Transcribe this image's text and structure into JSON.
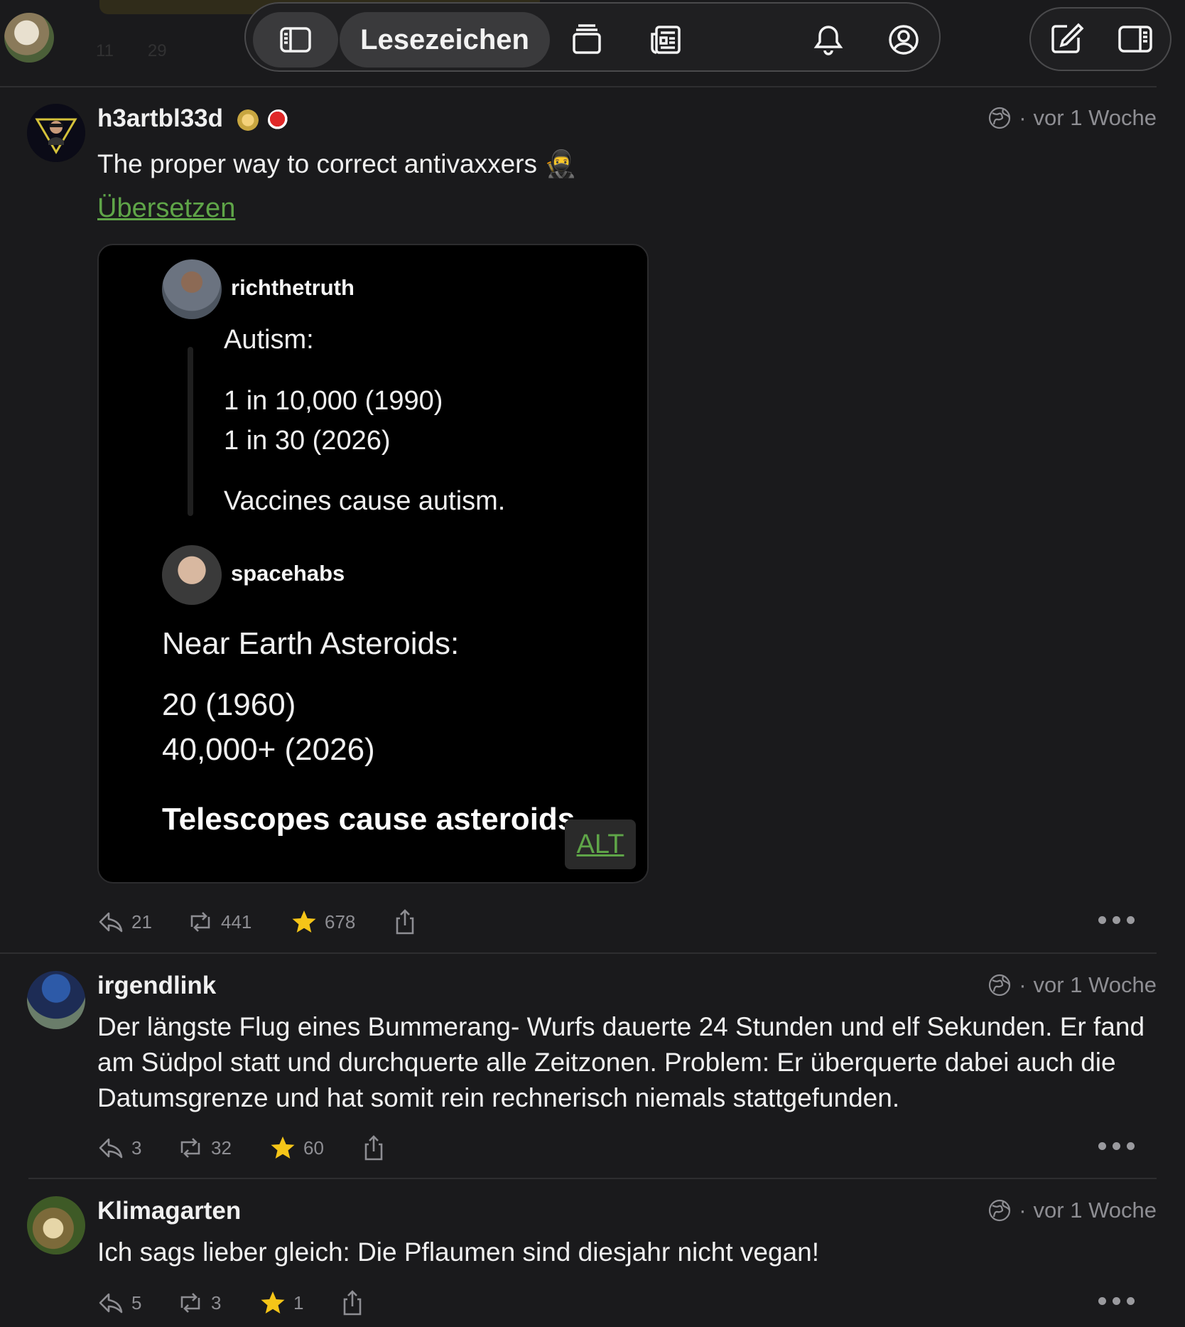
{
  "topbar": {
    "active_tab_label": "Lesezeichen",
    "ghost_counts": {
      "reply": "11",
      "boost": "29"
    }
  },
  "posts": [
    {
      "username": "h3artbl33d",
      "time": "vor 1 Woche",
      "text": "The proper way to correct antivaxxers 🥷",
      "translate_label": "Übersetzen",
      "replies": "21",
      "boosts": "441",
      "favourites": "678",
      "media": {
        "user1": "richthetruth",
        "heading1": "Autism:",
        "line1": "1 in 10,000 (1990)",
        "line2": "1 in 30 (2026)",
        "conclusion1": "Vaccines cause autism.",
        "user2": "spacehabs",
        "heading2": "Near Earth Asteroids:",
        "line3": "20 (1960)",
        "line4": "40,000+ (2026)",
        "conclusion2": "Telescopes cause asteroids.",
        "alt_label": "ALT"
      }
    },
    {
      "username": "irgendlink",
      "time": "vor 1 Woche",
      "text": "Der längste Flug eines Bummerang- Wurfs dauerte 24 Stunden und elf Sekunden. Er fand am Südpol statt und durchquerte alle Zeitzonen. Problem: Er überquerte dabei auch die Datumsgrenze und hat somit rein rechnerisch niemals stattgefunden.",
      "replies": "3",
      "boosts": "32",
      "favourites": "60"
    },
    {
      "username": "Klimagarten",
      "time": "vor 1 Woche",
      "text": "Ich sags lieber gleich: Die Pflaumen sind diesjahr nicht vegan!",
      "replies": "5",
      "boosts": "3",
      "favourites": "1"
    }
  ],
  "colors": {
    "background": "#1a1a1c",
    "link_green": "#5fa548",
    "favourite_yellow": "#f5c518",
    "muted": "#8e8e93"
  },
  "icons": [
    "sidebar-icon",
    "stack-icon",
    "news-icon",
    "bell-icon",
    "profile-icon",
    "compose-icon",
    "side-panel-icon",
    "globe-icon",
    "reply-icon",
    "boost-icon",
    "star-icon",
    "share-icon",
    "more-icon"
  ]
}
